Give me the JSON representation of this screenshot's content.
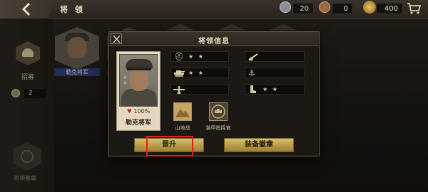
{
  "header": {
    "title": "将 领",
    "resources": [
      {
        "icon": "silver-medal-icon",
        "value": "20"
      },
      {
        "icon": "bronze-medal-icon",
        "value": "0"
      },
      {
        "icon": "gold-star-medal-icon",
        "value": "400"
      }
    ]
  },
  "sidebar": {
    "recruit_label": "招募",
    "medal_count": "2",
    "badge_label": "将领徽章"
  },
  "background_card": {
    "name": "勒克将军"
  },
  "modal": {
    "title": "将领信息",
    "general": {
      "name": "勒克将军",
      "hp": "100%"
    },
    "skills_left": [
      {
        "icon": "helmet-icon",
        "stars": "★ ★"
      },
      {
        "icon": "tank-icon",
        "stars": "★ ★"
      },
      {
        "icon": "plane-icon",
        "stars": ""
      }
    ],
    "skills_right": [
      {
        "icon": "artillery-icon",
        "stars": ""
      },
      {
        "icon": "anchor-icon",
        "stars": ""
      },
      {
        "icon": "boot-icon",
        "stars": "★ ★"
      }
    ],
    "specialties": [
      {
        "icon": "mountain-icon",
        "label": "山地战"
      },
      {
        "icon": "armor-command-icon",
        "label": "装甲指挥官"
      }
    ],
    "buttons": {
      "promote": "晋升",
      "equip_badge": "装备徽章"
    }
  }
}
